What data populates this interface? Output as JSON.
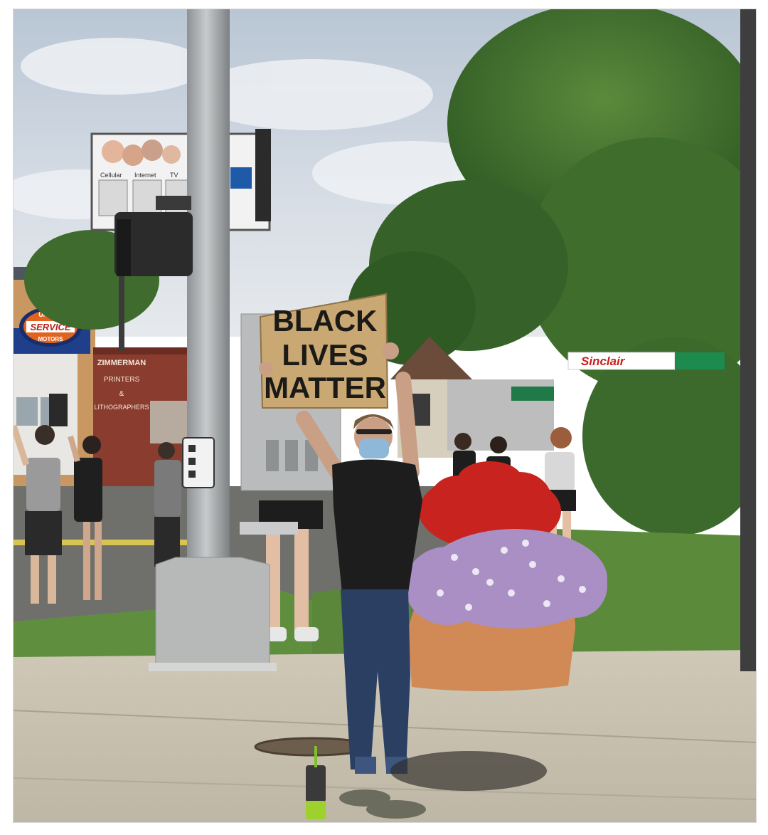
{
  "photo": {
    "protest_sign": {
      "line1": "BLACK",
      "line2": "LIVES",
      "line3": "MATTER"
    },
    "storefront_sign": {
      "line1": "UNITED",
      "line2": "SERVICE",
      "line3": "MOTORS"
    },
    "printer_sign": {
      "line1": "ZIMMERMAN",
      "line2": "PRINTERS",
      "line3": "&",
      "line4": "LITHOGRAPHERS"
    },
    "gas_station_sign": "Sinclair",
    "billboard": {
      "label1": "Cellular",
      "label2": "Internet",
      "label3": "TV"
    }
  },
  "colors": {
    "sky": "#c9d3df",
    "cardboard": "#c9a873",
    "pole": "#a8acae",
    "grass": "#5f8f3e",
    "sidewalk": "#c9c2b2",
    "planter": "#d18a56",
    "red_flowers": "#c8231e",
    "purple_flowers": "#a98fc4"
  }
}
